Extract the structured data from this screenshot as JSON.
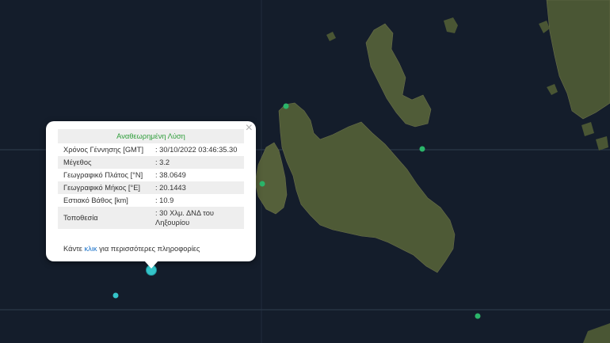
{
  "popup": {
    "title": "Αναθεωρημένη Λύση",
    "close_label": "×",
    "rows": [
      {
        "label": "Χρόνος Γέννησης [GMT]",
        "value": ": 30/10/2022 03:46:35.30"
      },
      {
        "label": "Μέγεθος",
        "value": ": 3.2"
      },
      {
        "label": "Γεωγραφικό Πλάτος [°N]",
        "value": ": 38.0649"
      },
      {
        "label": "Γεωγραφικό Μήκος [°E]",
        "value": ": 20.1443"
      },
      {
        "label": "Εστιακό Βάθος [km]",
        "value": ": 10.9"
      },
      {
        "label": "Τοποθεσία",
        "value": ": 30 Χλμ. ΔΝΔ του Ληξουρίου"
      }
    ],
    "footer_prefix": "Κάντε ",
    "footer_link": "κλικ",
    "footer_suffix": " για περισσότερες πληροφορίες"
  },
  "colors": {
    "sea": "#141d2b",
    "land": "#4e5a36",
    "marker_green": "#2bb56a",
    "marker_cyan": "#34c4c9",
    "title_green": "#2e9e3a",
    "link": "#1a72c9"
  }
}
